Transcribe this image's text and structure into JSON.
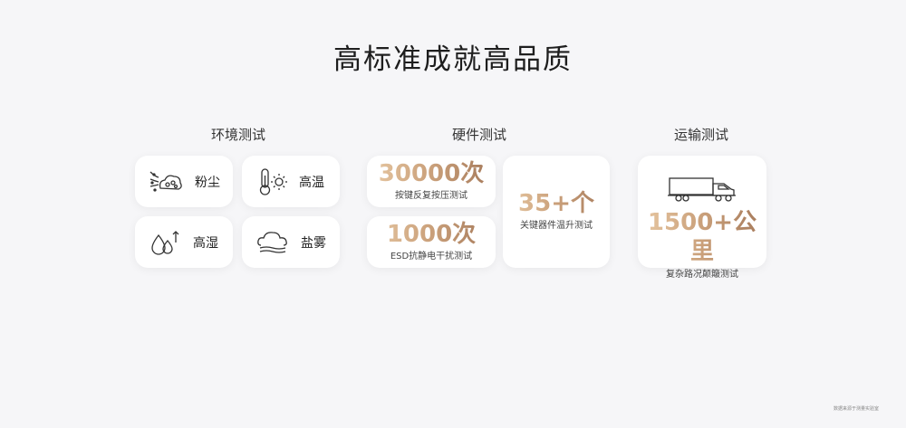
{
  "title": "高标准成就高品质",
  "sections": {
    "environment": {
      "title": "环境测试",
      "items": [
        {
          "label": "粉尘",
          "icon": "dust-icon"
        },
        {
          "label": "高温",
          "icon": "thermometer-sun-icon"
        },
        {
          "label": "高湿",
          "icon": "humidity-icon"
        },
        {
          "label": "盐雾",
          "icon": "salt-fog-cloud-icon"
        }
      ]
    },
    "hardware": {
      "title": "硬件测试",
      "items": [
        {
          "value": "30000次",
          "desc": "按键反复按压测试"
        },
        {
          "value": "1000次",
          "desc": "ESD抗静电干扰测试"
        },
        {
          "value": "35+个",
          "desc": "关键器件温升测试"
        }
      ]
    },
    "transport": {
      "title": "运输测试",
      "value": "1500+公里",
      "desc": "复杂路况颠簸测试",
      "icon": "truck-icon"
    }
  },
  "footer": "数据来源于测量实验室",
  "colors": {
    "accent_light": "#e8c9a4",
    "accent_dark": "#a47859",
    "card": "#ffffff",
    "background": "#f6f6f8"
  }
}
